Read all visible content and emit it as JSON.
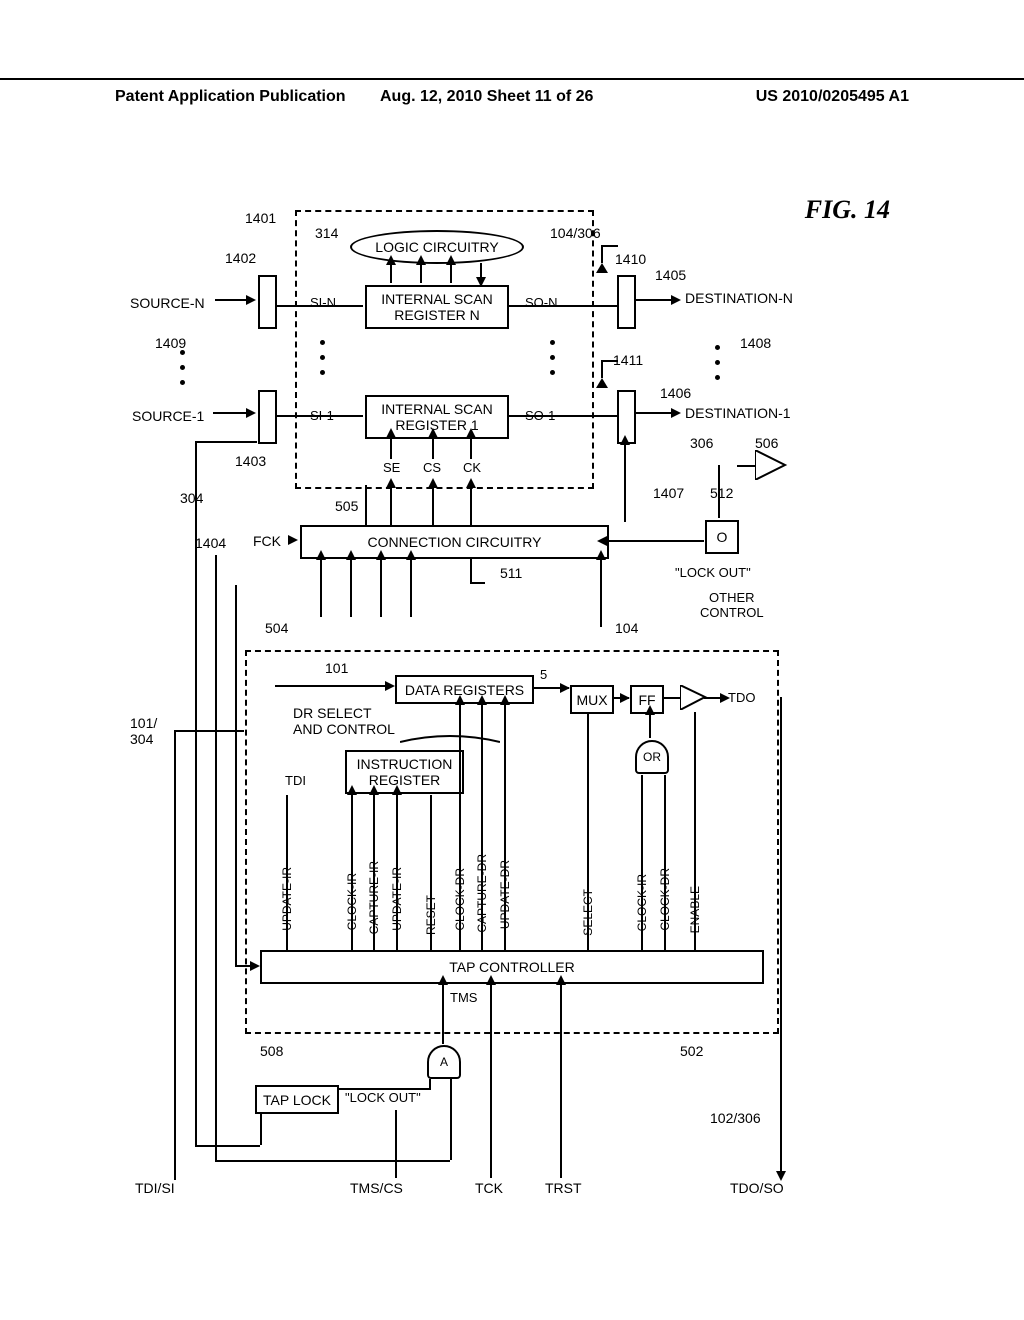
{
  "header": {
    "left": "Patent Application Publication",
    "mid": "Aug. 12, 2010  Sheet 11 of 26",
    "right": "US 2010/0205495 A1"
  },
  "figure": {
    "title": "FIG.  14",
    "refs": {
      "r1401": "1401",
      "r1402": "1402",
      "r1409": "1409",
      "r1403": "1403",
      "r1404": "1404",
      "r304": "304",
      "r314": "314",
      "r104_306": "104/306",
      "r1410": "1410",
      "r1405": "1405",
      "r1411": "1411",
      "r1408": "1408",
      "r1406": "1406",
      "r306": "306",
      "r506": "506",
      "r1407": "1407",
      "r512": "512",
      "r505": "505",
      "r511": "511",
      "r504": "504",
      "r104": "104",
      "r101": "101",
      "r101_304": "101/\n304",
      "r508": "508",
      "r502": "502",
      "r102_306": "102/306",
      "r5": "5"
    },
    "blocks": {
      "logic_circuitry": "LOGIC CIRCUITRY",
      "scan_n": "INTERNAL SCAN\nREGISTER N",
      "scan_1": "INTERNAL SCAN\nREGISTER 1",
      "connection": "CONNECTION CIRCUITRY",
      "data_registers": "DATA REGISTERS",
      "dr_select": "DR SELECT\nAND CONTROL",
      "instruction_register": "INSTRUCTION\nREGISTER",
      "tap_controller": "TAP CONTROLLER",
      "tap_lock": "TAP LOCK",
      "mux": "MUX",
      "ff": "FF",
      "or": "OR",
      "a": "A",
      "o": "O"
    },
    "signals": {
      "source_n": "SOURCE-N",
      "source_1": "SOURCE-1",
      "dest_n": "DESTINATION-N",
      "dest_1": "DESTINATION-1",
      "si_n": "SI-N",
      "so_n": "SO-N",
      "si_1": "SI-1",
      "so_1": "SO-1",
      "se": "SE",
      "cs": "CS",
      "ck": "CK",
      "fck": "FCK",
      "lock_out": "\"LOCK OUT\"",
      "other_control": "OTHER\nCONTROL",
      "tdo": "TDO",
      "tdi": "TDI",
      "update_ir": "UPDATE-IR",
      "clock_ir": "CLOCK-IR",
      "capture_ir": "CAPTURE-IR",
      "update_ir2": "UPDATE-IR",
      "reset": "RESET",
      "clock_dr": "CLOCK-DR",
      "capture_dr": "CAPTURE-DR",
      "update_dr": "UPDATE-DR",
      "select": "SELECT",
      "clock_ir2": "CLOCK-IR",
      "clock_dr2": "CLOCK-DR",
      "enable": "ENABLE",
      "tms": "TMS",
      "tdi_si": "TDI/SI",
      "tms_cs": "TMS/CS",
      "tck": "TCK",
      "trst": "TRST",
      "tdo_so": "TDO/SO"
    }
  }
}
